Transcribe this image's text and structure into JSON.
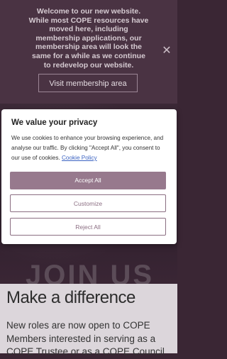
{
  "notice": {
    "message": "Welcome to our new website. While most COPE resources have moved here, including membership applications, our membership area will look the same for a while as we continue to redevelop our website.",
    "button_label": "Visit membership area",
    "close_icon": "close-icon"
  },
  "hero": {
    "background_word": "JOIN US"
  },
  "cookie": {
    "title": "We value your privacy",
    "body": "We use cookies to enhance your browsing experience, and analyse our traffic. By clicking \"Accept All\", you consent to our use of cookies.",
    "policy_link": "Cookie Policy",
    "accept_label": "Accept All",
    "customize_label": "Customize",
    "reject_label": "Reject All",
    "accent_color": "#97798d"
  },
  "content": {
    "heading": "Make a difference",
    "text": "New roles are now open to COPE Members interested in serving as a COPE Trustee or as a COPE Council"
  }
}
